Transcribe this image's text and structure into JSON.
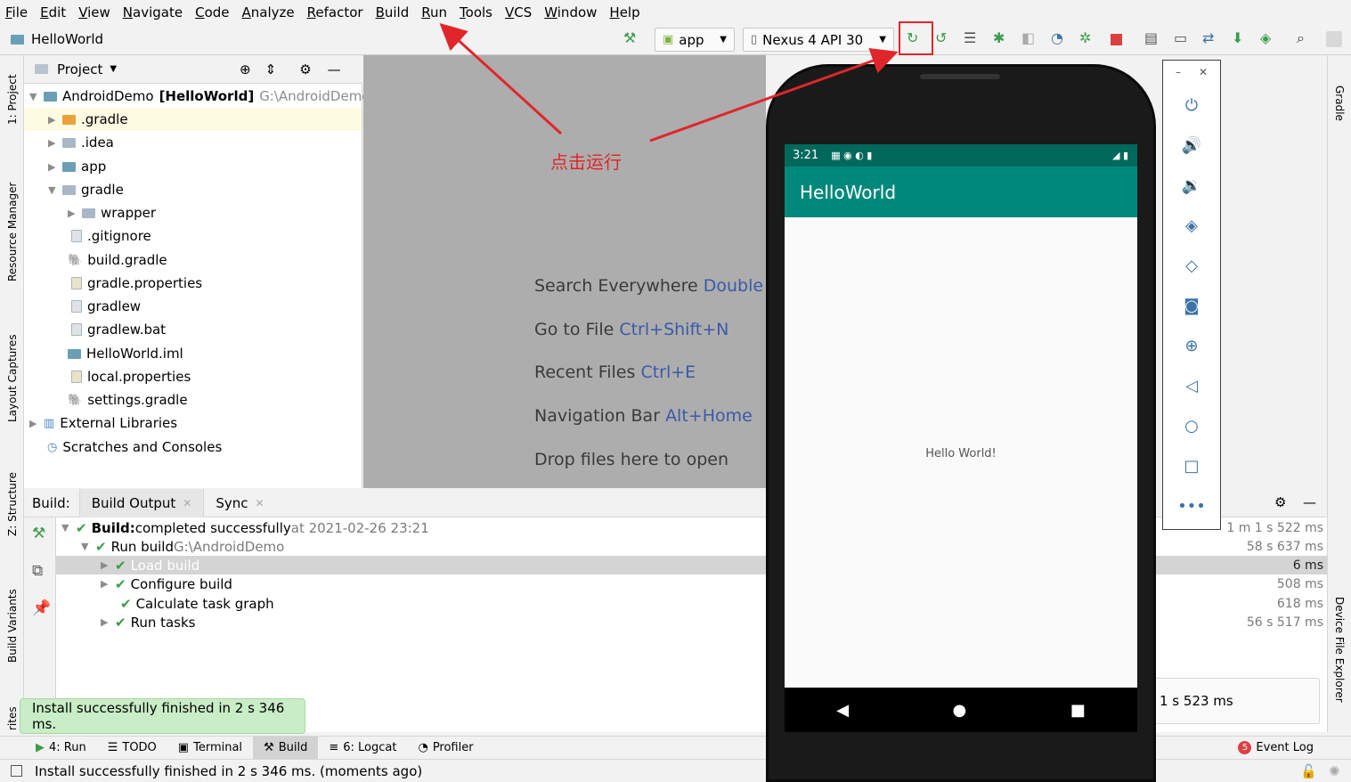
{
  "menu": [
    "File",
    "Edit",
    "View",
    "Navigate",
    "Code",
    "Analyze",
    "Refactor",
    "Build",
    "Run",
    "Tools",
    "VCS",
    "Window",
    "Help"
  ],
  "breadcrumb": "HelloWorld",
  "toolbar": {
    "run_config": "app",
    "device": "Nexus 4 API 30"
  },
  "left_tools": {
    "project": "1: Project",
    "resource_manager": "Resource Manager",
    "layout_captures": "Layout Captures",
    "structure": "Z: Structure",
    "build_variants": "Build Variants",
    "favorites": "rites"
  },
  "right_tools": {
    "gradle": "Gradle",
    "device_file_explorer": "Device File Explorer"
  },
  "project_panel": {
    "title": "Project",
    "root": {
      "name": "AndroidDemo",
      "module": "[HelloWorld]",
      "path": "G:\\AndroidDemo"
    },
    "items": [
      ".gradle",
      ".idea",
      "app",
      "gradle",
      "wrapper",
      ".gitignore",
      "build.gradle",
      "gradle.properties",
      "gradlew",
      "gradlew.bat",
      "HelloWorld.iml",
      "local.properties",
      "settings.gradle",
      "External Libraries",
      "Scratches and Consoles"
    ]
  },
  "editor_hints": [
    {
      "text": "Search Everywhere",
      "key": "Double"
    },
    {
      "text": "Go to File",
      "key": "Ctrl+Shift+N"
    },
    {
      "text": "Recent Files",
      "key": "Ctrl+E"
    },
    {
      "text": "Navigation Bar",
      "key": "Alt+Home"
    },
    {
      "text": "Drop files here to open",
      "key": ""
    }
  ],
  "annotation": "点击运行",
  "build_panel": {
    "label": "Build:",
    "tabs": [
      "Build Output",
      "Sync"
    ],
    "rows": [
      {
        "bold": "Build:",
        "text": " completed successfully",
        "meta": " at 2021-02-26 23:21",
        "time": "1 m 1 s 522 ms"
      },
      {
        "text": "Run build",
        "meta": " G:\\AndroidDemo",
        "time": "58 s 637 ms"
      },
      {
        "text": "Load build",
        "time": "6 ms"
      },
      {
        "text": "Configure build",
        "time": "508 ms"
      },
      {
        "text": "Calculate task graph",
        "time": "618 ms"
      },
      {
        "text": "Run tasks",
        "time": "56 s 517 ms"
      }
    ],
    "extra_time": "1 s 523 ms"
  },
  "balloon": "Install successfully finished in 2 s 346 ms.",
  "bottom_tabs": [
    "4: Run",
    "TODO",
    "Terminal",
    "Build",
    "6: Logcat",
    "Profiler"
  ],
  "event_log": {
    "count": "5",
    "label": "Event Log"
  },
  "status": "Install successfully finished in 2 s 346 ms. (moments ago)",
  "phone": {
    "time": "3:21",
    "app_title": "HelloWorld",
    "content": "Hello World!"
  }
}
